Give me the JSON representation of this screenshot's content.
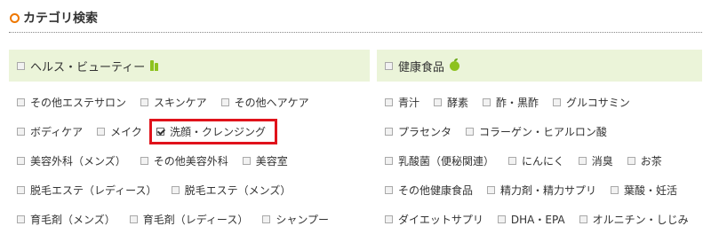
{
  "section_title": "カテゴリ検索",
  "colors": {
    "accent": "#ee7700",
    "band": "#ebf4d9",
    "icon_green": "#8dc21f",
    "highlight": "#e0121b"
  },
  "left": {
    "header": {
      "label": "ヘルス・ビューティー",
      "icon": "bottle-icon"
    },
    "rows": [
      [
        {
          "label": "その他エステサロン",
          "checked": false
        },
        {
          "label": "スキンケア",
          "checked": false
        },
        {
          "label": "その他ヘアケア",
          "checked": false
        }
      ],
      [
        {
          "label": "ボディケア",
          "checked": false
        },
        {
          "label": "メイク",
          "checked": false
        },
        {
          "label": "洗顔・クレンジング",
          "checked": true
        }
      ],
      [
        {
          "label": "美容外科（メンズ）",
          "checked": false
        },
        {
          "label": "その他美容外科",
          "checked": false
        },
        {
          "label": "美容室",
          "checked": false
        }
      ],
      [
        {
          "label": "脱毛エステ（レディース）",
          "checked": false
        },
        {
          "label": "脱毛エステ（メンズ）",
          "checked": false
        }
      ],
      [
        {
          "label": "育毛剤（メンズ）",
          "checked": false
        },
        {
          "label": "育毛剤（レディース）",
          "checked": false
        },
        {
          "label": "シャンプー",
          "checked": false
        }
      ]
    ]
  },
  "right": {
    "header": {
      "label": "健康食品",
      "icon": "apple-icon"
    },
    "rows": [
      [
        {
          "label": "青汁",
          "checked": false
        },
        {
          "label": "酵素",
          "checked": false
        },
        {
          "label": "酢・黒酢",
          "checked": false
        },
        {
          "label": "グルコサミン",
          "checked": false
        }
      ],
      [
        {
          "label": "プラセンタ",
          "checked": false
        },
        {
          "label": "コラーゲン・ヒアルロン酸",
          "checked": false
        }
      ],
      [
        {
          "label": "乳酸菌（便秘関連）",
          "checked": false
        },
        {
          "label": "にんにく",
          "checked": false
        },
        {
          "label": "消臭",
          "checked": false
        },
        {
          "label": "お茶",
          "checked": false
        }
      ],
      [
        {
          "label": "その他健康食品",
          "checked": false
        },
        {
          "label": "精力剤・精力サプリ",
          "checked": false
        },
        {
          "label": "葉酸・妊活",
          "checked": false
        }
      ],
      [
        {
          "label": "ダイエットサプリ",
          "checked": false
        },
        {
          "label": "DHA・EPA",
          "checked": false
        },
        {
          "label": "オルニチン・しじみ",
          "checked": false
        }
      ]
    ]
  }
}
